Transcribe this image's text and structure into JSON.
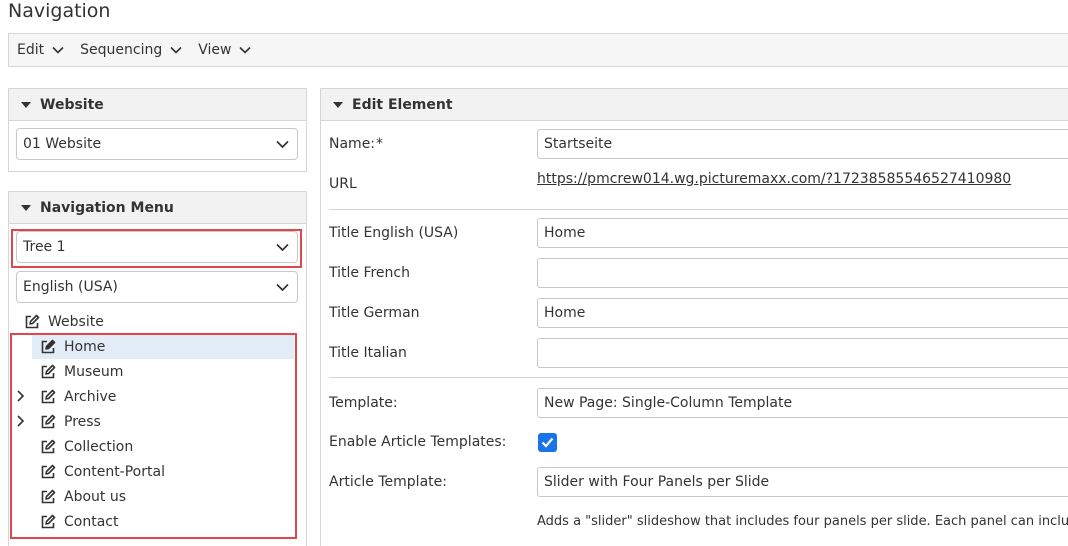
{
  "page": {
    "title": "Navigation"
  },
  "menubar": {
    "items": [
      "Edit",
      "Sequencing",
      "View"
    ]
  },
  "website_panel": {
    "title": "Website",
    "selected": "01 Website"
  },
  "nav_panel": {
    "title": "Navigation Menu",
    "tree_select": "Tree 1",
    "language_select": "English (USA)",
    "root": "Website",
    "items": [
      {
        "label": "Home",
        "selected": true,
        "expandable": false
      },
      {
        "label": "Museum",
        "selected": false,
        "expandable": false
      },
      {
        "label": "Archive",
        "selected": false,
        "expandable": true
      },
      {
        "label": "Press",
        "selected": false,
        "expandable": true
      },
      {
        "label": "Collection",
        "selected": false,
        "expandable": false
      },
      {
        "label": "Content-Portal",
        "selected": false,
        "expandable": false
      },
      {
        "label": "About us",
        "selected": false,
        "expandable": false
      },
      {
        "label": "Contact",
        "selected": false,
        "expandable": false
      }
    ]
  },
  "edit_panel": {
    "title": "Edit Element",
    "name_label": "Name:",
    "required_mark": "*",
    "name_value": "Startseite",
    "url_label": "URL",
    "url_value": "https://pmcrew014.wg.picturemaxx.com/?17238585546527410980",
    "title_en_label": "Title English (USA)",
    "title_en_value": "Home",
    "title_fr_label": "Title French",
    "title_fr_value": "",
    "title_de_label": "Title German",
    "title_de_value": "Home",
    "title_it_label": "Title Italian",
    "title_it_value": "",
    "template_label": "Template:",
    "template_value": "New Page: Single-Column Template",
    "enable_article_label": "Enable Article Templates:",
    "enable_article_checked": true,
    "article_template_label": "Article Template:",
    "article_template_value": "Slider with Four Panels per Slide",
    "article_template_hint": "Adds a \"slider\" slideshow that includes four panels per slide. Each panel can include"
  },
  "colors": {
    "highlight": "#e0464a",
    "selected_row": "#e3edf8",
    "checkbox": "#1a73e8"
  }
}
